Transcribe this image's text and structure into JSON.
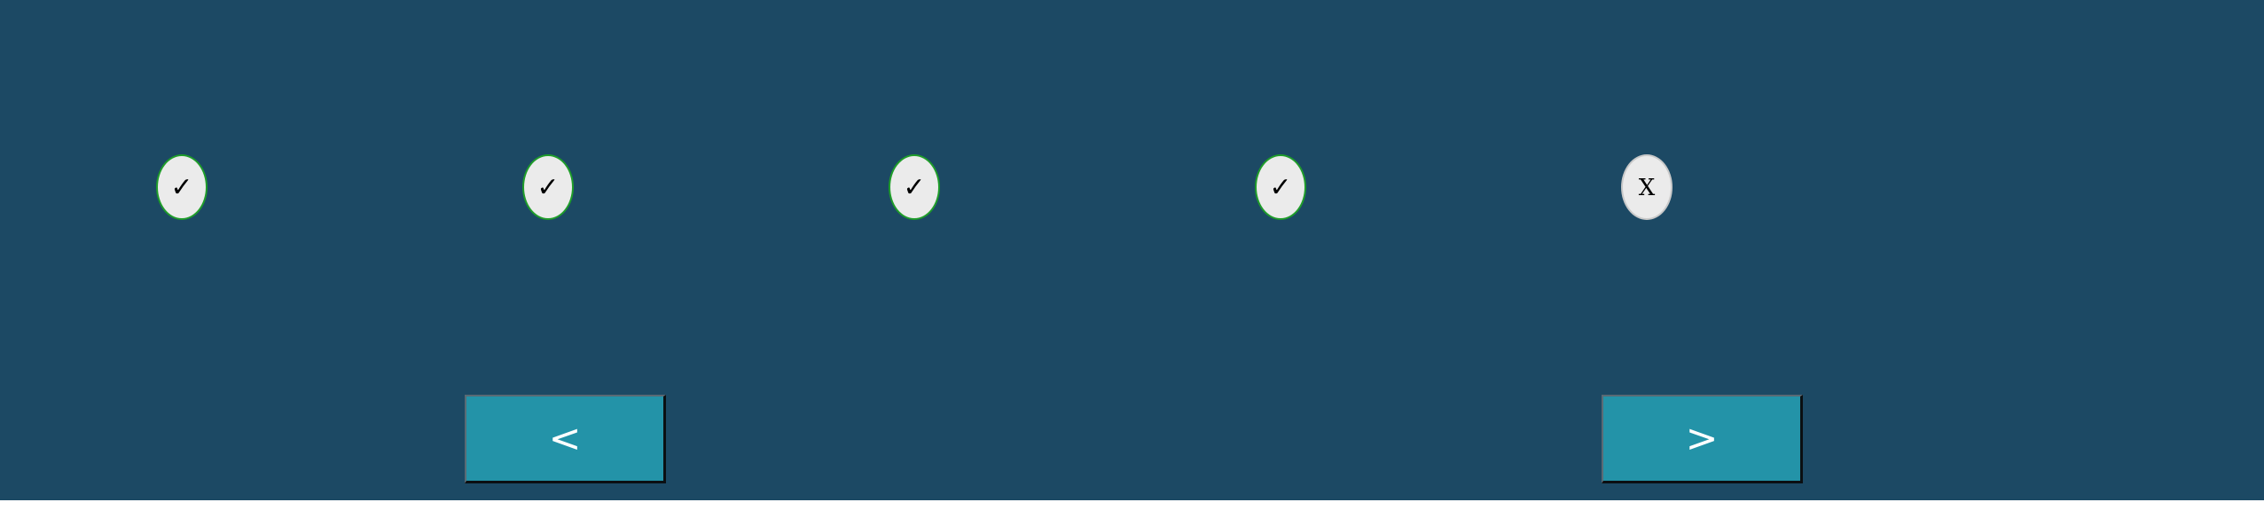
{
  "progress": {
    "steps": [
      {
        "state": "done",
        "glyph": "✓",
        "color": "#1f9d2a"
      },
      {
        "state": "done",
        "glyph": "✓",
        "color": "#1f9d2a"
      },
      {
        "state": "done",
        "glyph": "✓",
        "color": "#1f9d2a"
      },
      {
        "state": "done",
        "glyph": "✓",
        "color": "#1f9d2a"
      },
      {
        "state": "failed",
        "glyph": "X",
        "color": "#c9c9c9"
      }
    ]
  },
  "navigation": {
    "prev_label": "<",
    "next_label": ">"
  },
  "colors": {
    "background": "#1c4964",
    "button": "#2393a8",
    "circle_fill": "#ebebeb"
  }
}
